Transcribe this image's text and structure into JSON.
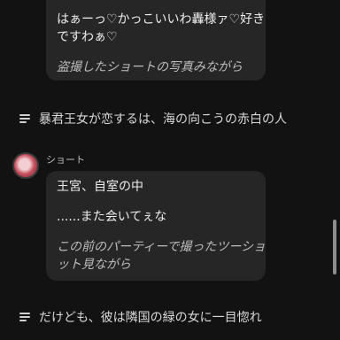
{
  "chat": {
    "bubble1": {
      "line1": "はぁーっ♡かっこいいわ轟様ァ♡好き",
      "line2": "ですわぁ♡",
      "line3": "盗撮したショートの写真みながら"
    },
    "narration1": "暴君王女が恋するは、海の向こうの赤白の人",
    "speaker": "ショート",
    "bubble2": {
      "line1": "王宮、自室の中",
      "line2": "......また会いてぇな",
      "line3": "この前のパーティーで撮ったツーショ",
      "line4": "ット見ながら"
    },
    "narration2": "だけども、彼は隣国の緑の女に一目惚れ"
  },
  "icons": {
    "narration": "text-lines-icon",
    "avatar": "avatar-image"
  }
}
